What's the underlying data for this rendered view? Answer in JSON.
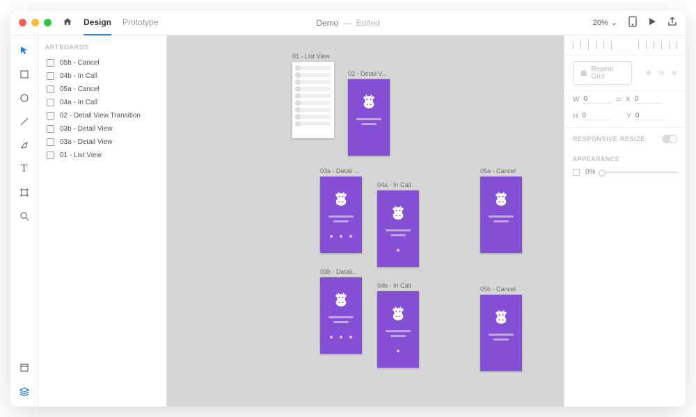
{
  "titlebar": {
    "tabs": {
      "design": "Design",
      "prototype": "Prototype"
    },
    "doc_name": "Demo",
    "doc_status": "Edited",
    "zoom": "20%"
  },
  "artboards_header": "Artboards",
  "artboards": [
    {
      "label": "05b - Cancel"
    },
    {
      "label": "04b - In Call"
    },
    {
      "label": "05a - Cancel"
    },
    {
      "label": "04a - In Call"
    },
    {
      "label": "02 - Detail View Transition"
    },
    {
      "label": "03b - Detail View"
    },
    {
      "label": "03a - Detail View"
    },
    {
      "label": "01 - List View"
    }
  ],
  "canvas": {
    "r0": {
      "a": "01 - List View",
      "b": "02 - Detail V..."
    },
    "r1": {
      "a": "03a - Detail ...",
      "b": "04a - In Call",
      "c": "05a - Cancel"
    },
    "r2": {
      "a": "03b - Detail...",
      "b": "04b - In Call",
      "c": "05b - Cancel"
    }
  },
  "inspector": {
    "repeat_grid": "Repeat Grid",
    "dims": {
      "w_label": "W",
      "w": "0",
      "h_label": "H",
      "h": "0",
      "x_label": "X",
      "x": "0",
      "y_label": "Y",
      "y": "0"
    },
    "responsive": "Responsive Resize",
    "appearance": "Appearance",
    "opacity": "0%"
  }
}
